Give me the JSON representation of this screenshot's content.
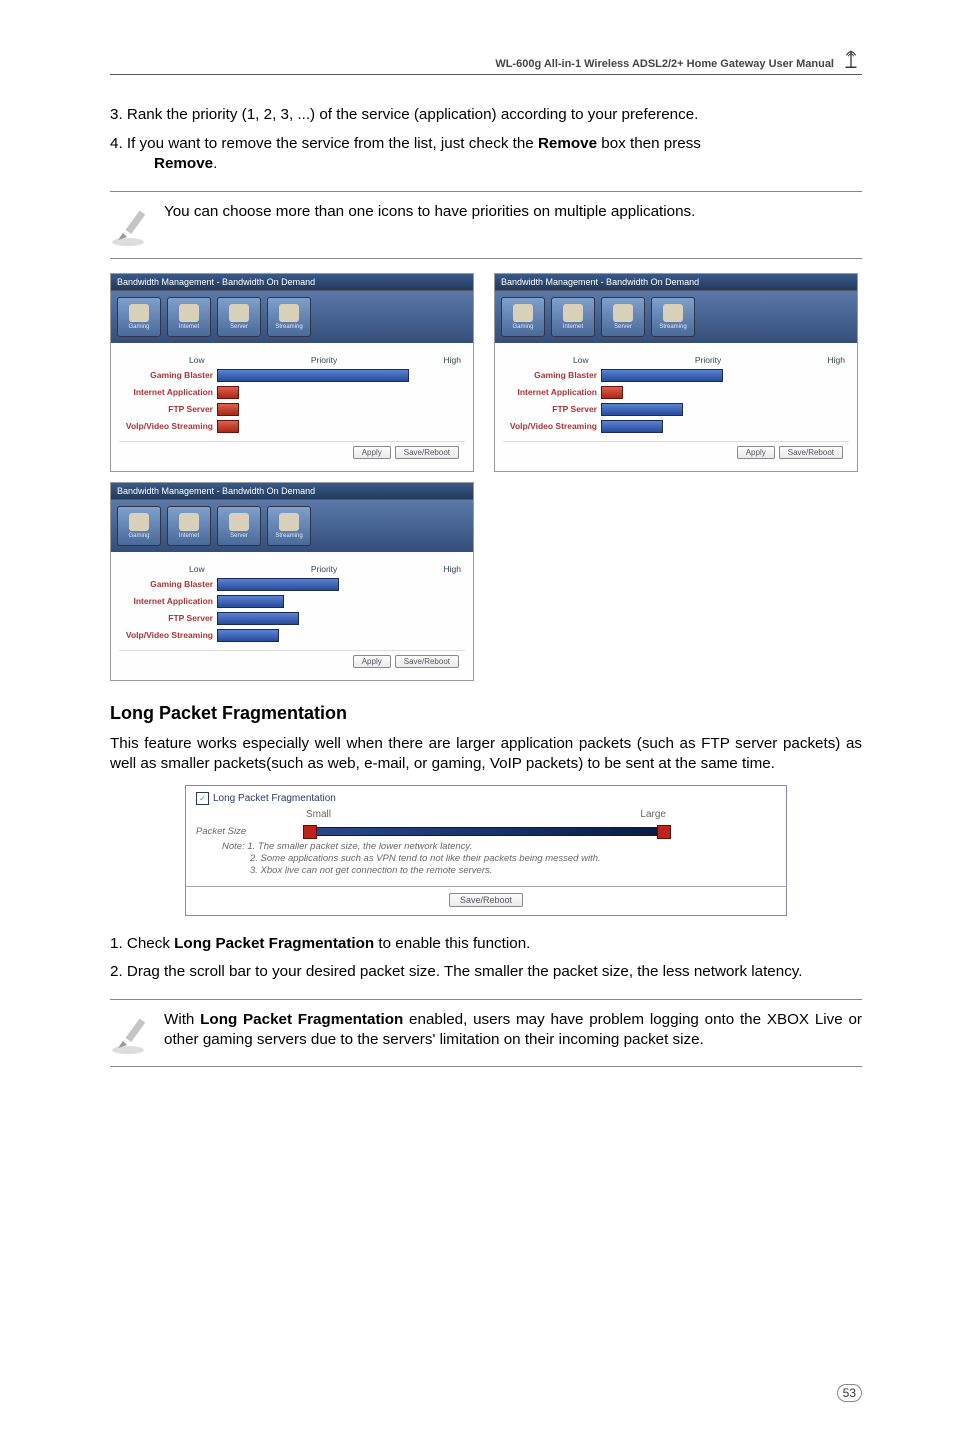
{
  "header": {
    "title": "WL-600g All-in-1 Wireless ADSL2/2+ Home Gateway User Manual"
  },
  "step3": "3. Rank the priority (1, 2, 3, ...) of the service (application) according to your preference.",
  "step4_a": "4. If you want to remove the service from the list, just check the ",
  "step4_b": "Remove",
  "step4_c": " box then press ",
  "step4_d": "Remove",
  "step4_e": ".",
  "note1": "You can choose more than one icons to have priorities on multiple applications.",
  "cfg": {
    "title1": "Bandwidth Management - Bandwidth On Demand",
    "title2": "Bandwidth Management - Bandwidth On Demand",
    "title3": "Bandwidth Management - Bandwidth On Demand",
    "prio_label": "Priority",
    "low": "Low",
    "high": "High",
    "rows": {
      "r1": "Gaming Blaster",
      "r2": "Internet Application",
      "r3": "FTP Server",
      "r4": "VoIp/Video Streaming"
    },
    "apply": "Apply",
    "save": "Save/Reboot"
  },
  "h2": "Long Packet Fragmentation",
  "para": "This feature works especially well when there are larger application packets (such as FTP server packets) as well as smaller packets(such as web, e-mail, or gaming, VoIP packets) to be sent at the same time.",
  "frag": {
    "title": "Long Packet Fragmentation",
    "small": "Small",
    "large": "Large",
    "pkt": "Packet Size",
    "n1": "Note: 1. The smaller packet size, the lower network latency.",
    "n2": "2. Some applications such as VPN tend to not like their packets being messed with.",
    "n3": "3. Xbox live can not get connection to the remote servers.",
    "btn": "Save/Reboot"
  },
  "s1_a": "1. Check ",
  "s1_b": "Long Packet Fragmentation",
  "s1_c": " to enable this function.",
  "s2": "2. Drag the scroll bar to your desired packet size. The smaller the packet size, the less network latency.",
  "note2_a": "With ",
  "note2_b": "Long Packet Fragmentation",
  "note2_c": " enabled, users may have problem logging onto the XBOX Live or other gaming servers due to the servers' limitation on their incoming packet size.",
  "pagenum": "53"
}
